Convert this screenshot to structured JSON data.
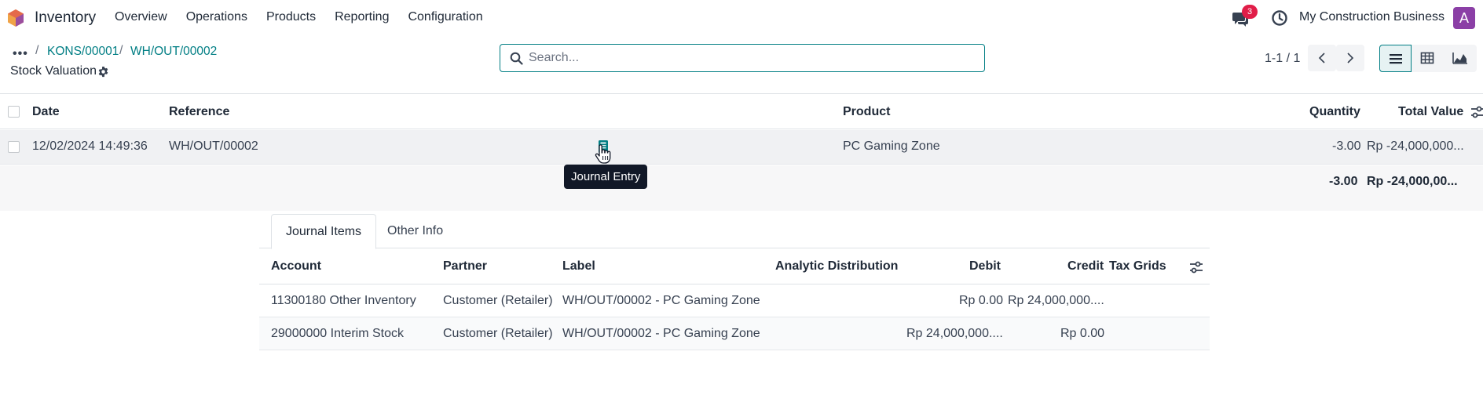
{
  "navbar": {
    "app_name": "Inventory",
    "menu": [
      "Overview",
      "Operations",
      "Products",
      "Reporting",
      "Configuration"
    ],
    "chat_badge": "3",
    "company": "My Construction Business",
    "avatar_letter": "A"
  },
  "control_panel": {
    "breadcrumb": [
      "KONS/00001",
      "WH/OUT/00002"
    ],
    "title": "Stock Valuation",
    "search_placeholder": "Search...",
    "pager": "1-1 / 1"
  },
  "list": {
    "headers": {
      "date": "Date",
      "reference": "Reference",
      "product": "Product",
      "quantity": "Quantity",
      "total_value": "Total Value"
    },
    "row": {
      "date": "12/02/2024 14:49:36",
      "reference": "WH/OUT/00002",
      "product": "PC Gaming Zone",
      "quantity": "-3.00",
      "total_value": "Rp -24,000,000..."
    },
    "totals": {
      "quantity": "-3.00",
      "total_value": "Rp -24,000,00..."
    },
    "tooltip": "Journal Entry"
  },
  "detail": {
    "tabs": [
      "Journal Items",
      "Other Info"
    ],
    "headers": {
      "account": "Account",
      "partner": "Partner",
      "label": "Label",
      "analytic": "Analytic Distribution",
      "debit": "Debit",
      "credit": "Credit",
      "tax_grids": "Tax Grids"
    },
    "rows": [
      {
        "account": "11300180 Other Inventory",
        "partner": "Customer (Retailer)",
        "label": "WH/OUT/00002 - PC Gaming Zone",
        "debit": "Rp 0.00",
        "credit": "Rp 24,000,000...."
      },
      {
        "account": "29000000 Interim Stock",
        "partner": "Customer (Retailer)",
        "label": "WH/OUT/00002 - PC Gaming Zone",
        "debit": "Rp 24,000,000....",
        "credit": "Rp 0.00"
      }
    ]
  },
  "colors": {
    "accent": "#017e84",
    "avatar": "#8b3fa6",
    "badge": "#e11d48"
  }
}
